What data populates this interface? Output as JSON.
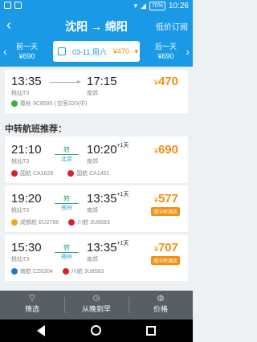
{
  "statusbar": {
    "time": "10:26",
    "battery": "70%"
  },
  "header": {
    "back": "‹",
    "title": "沈阳 → 绵阳",
    "low_price": "低价订阅"
  },
  "datebar": {
    "prev_label": "前一天",
    "prev_price": "¥690",
    "date": "03-11 周六",
    "date_price": "¥470",
    "next_label": "后一天",
    "next_price": "¥690"
  },
  "direct_flight": {
    "dep_time": "13:35",
    "dep_airport": "桃仙T3",
    "arr_time": "17:15",
    "arr_airport": "南郊",
    "price": "470",
    "currency": "¥",
    "airline": "春秋 9C8595 | 空客320(中)"
  },
  "section_title": "中转航班推荐：",
  "transfers": [
    {
      "dep_time": "21:10",
      "dep_airport": "桃仙T3",
      "via_label": "转",
      "via_city": "北京",
      "arr_time": "10:20",
      "arr_day": "+1天",
      "arr_airport": "南郊",
      "price": "690",
      "currency": "¥",
      "leg1": "国航 CA1626",
      "leg2": "国航 CA1451",
      "badge": ""
    },
    {
      "dep_time": "19:20",
      "dep_airport": "桃仙T3",
      "via_label": "转",
      "via_city": "郑州",
      "arr_time": "13:35",
      "arr_day": "+1天",
      "arr_airport": "南郊",
      "price": "577",
      "currency": "¥",
      "leg1": "成都航 EU2766",
      "leg2": "川航 3U8583",
      "badge": "赠中转酒店"
    },
    {
      "dep_time": "15:30",
      "dep_airport": "桃仙T3",
      "via_label": "转",
      "via_city": "郑州",
      "arr_time": "13:35",
      "arr_day": "+1天",
      "arr_airport": "南郊",
      "price": "707",
      "currency": "¥",
      "leg1": "南航 CZ6304",
      "leg2": "川航 3U8583",
      "badge": "赠中转酒店"
    }
  ],
  "bottombar": {
    "filter": "筛选",
    "sort": "从晚到早",
    "price": "价格"
  },
  "colors": {
    "primary": "#1a9ae6",
    "price": "#f29111",
    "transfer": "#2aa67a"
  }
}
